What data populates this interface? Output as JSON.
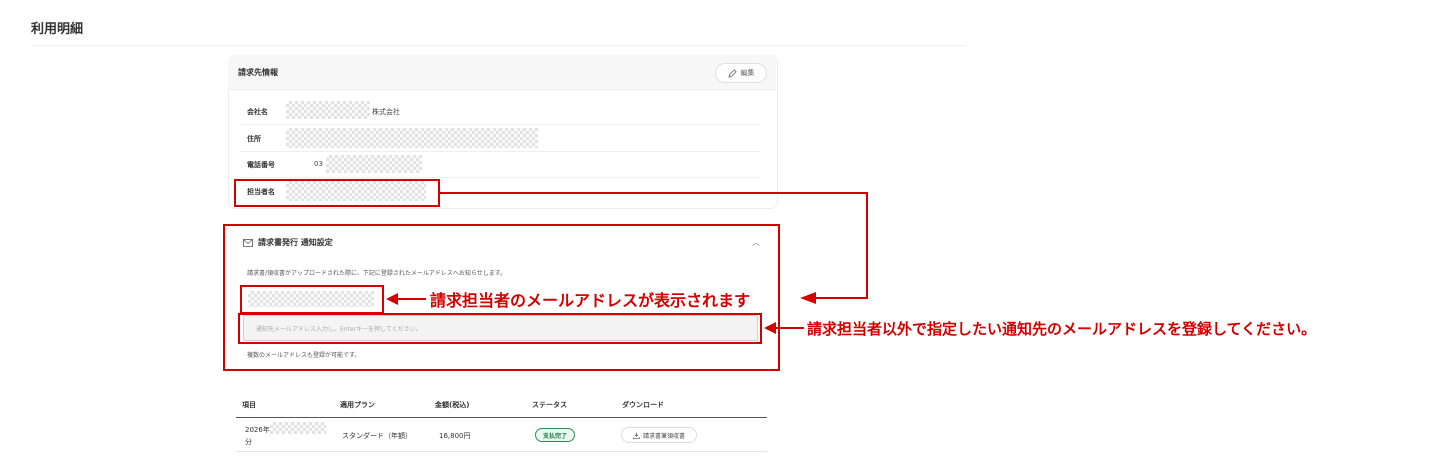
{
  "page": {
    "title": "利用明細"
  },
  "billing": {
    "title": "請求先情報",
    "edit_label": "編集",
    "fields": [
      {
        "label": "会社名",
        "value": "株式会社"
      },
      {
        "label": "住所",
        "value": ""
      },
      {
        "label": "電話番号",
        "value": "03"
      },
      {
        "label": "担当者名",
        "value": ""
      }
    ]
  },
  "notification": {
    "title": "請求書発行 通知設定",
    "description": "請求書/領収書がアップロードされた際に、下記に登録されたメールアドレスへお知らせします。",
    "input_placeholder": "通知先メールアドレス入力し、Enterキーを押してください。",
    "note": "複数のメールアドレスも登録が可能です。"
  },
  "callouts": {
    "contact_email": "請求担当者のメールアドレスが表示されます",
    "additional_email": "請求担当者以外で指定したい通知先のメールアドレスを登録してください。"
  },
  "table": {
    "headers": [
      "項目",
      "適用プラン",
      "金額(税込)",
      "ステータス",
      "ダウンロード"
    ],
    "rows": [
      {
        "item_prefix": "2026年",
        "item_suffix": "分",
        "plan": "スタンダード（年額）",
        "amount": "16,800円",
        "status": "支払完了",
        "download": "請求書兼領収書"
      }
    ]
  },
  "colors": {
    "annotation_red": "#d40000",
    "status_green": "#1d7a45"
  },
  "icons": [
    "pencil-icon",
    "envelope-icon",
    "chevron-up-icon",
    "download-icon",
    "arrow-left-icon"
  ]
}
